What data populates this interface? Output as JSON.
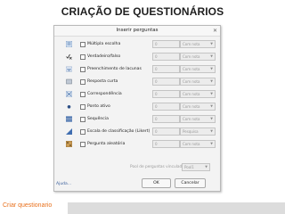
{
  "slide": {
    "title": "CRIAÇÃO DE QUESTIONÁRIOS",
    "caption": "Criar questionario"
  },
  "dialog": {
    "title": "Inserir perguntas",
    "rows": [
      {
        "label": "Múltipla escolha",
        "icon": "multiple-choice-icon",
        "count": "0",
        "option": "Com nota"
      },
      {
        "label": "Verdadeiro/falso",
        "icon": "true-false-icon",
        "count": "0",
        "option": "Com nota"
      },
      {
        "label": "Preenchimento de lacunas",
        "icon": "fill-blanks-icon",
        "count": "0",
        "option": "Com nota"
      },
      {
        "label": "Resposta curta",
        "icon": "short-answer-icon",
        "count": "0",
        "option": "Com nota"
      },
      {
        "label": "Correspondência",
        "icon": "matching-icon",
        "count": "0",
        "option": "Com nota"
      },
      {
        "label": "Ponto ativo",
        "icon": "hotspot-icon",
        "count": "0",
        "option": "Com nota"
      },
      {
        "label": "Sequência",
        "icon": "sequence-icon",
        "count": "0",
        "option": "Com nota"
      },
      {
        "label": "Escala de classificação (Likert)",
        "icon": "likert-scale-icon",
        "count": "0",
        "option": "Pesquisa"
      },
      {
        "label": "Pergunta aleatória",
        "icon": "random-question-icon",
        "count": "0",
        "option": "Com nota"
      }
    ],
    "pool_label": "Pool de perguntas vinculado:",
    "pool_value": "Pool1",
    "help": "Ajuda...",
    "ok": "OK",
    "cancel": "Cancelar"
  },
  "colors": {
    "caption": "#e8701c",
    "link": "#3a5f9c"
  }
}
